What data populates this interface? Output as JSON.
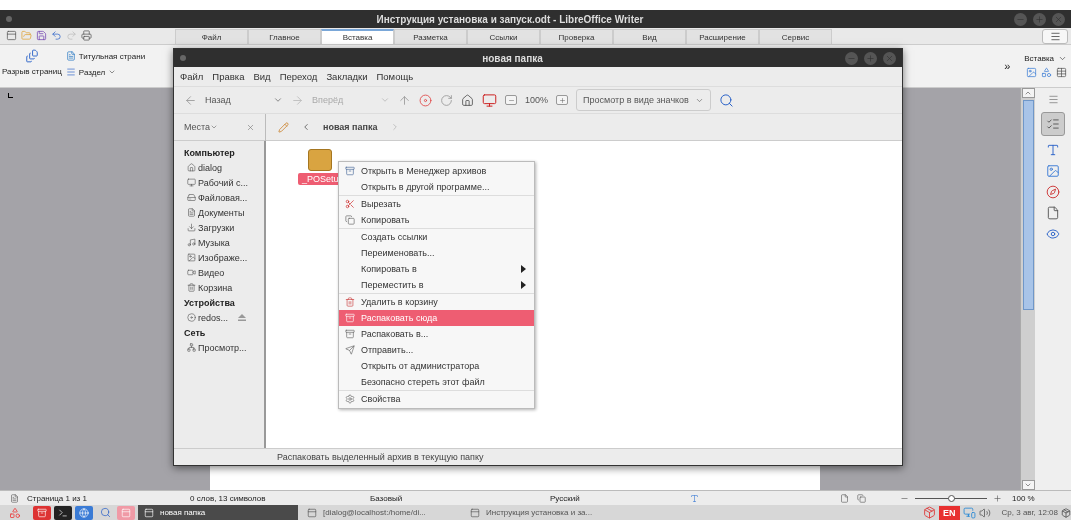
{
  "writer": {
    "title": "Инструкция установка и запуск.odt - LibreOffice Writer",
    "tabs": [
      {
        "label": "Файл",
        "selected": false
      },
      {
        "label": "Главное",
        "selected": false
      },
      {
        "label": "Вставка",
        "selected": true
      },
      {
        "label": "Разметка",
        "selected": false
      },
      {
        "label": "Ссылки",
        "selected": false
      },
      {
        "label": "Проверка",
        "selected": false
      },
      {
        "label": "Вид",
        "selected": false
      },
      {
        "label": "Расширение",
        "selected": false
      },
      {
        "label": "Сервис",
        "selected": false
      }
    ],
    "ribbon": {
      "page_break": "Разрыв страниц",
      "title_page": "Титульная страни",
      "section": "Раздел",
      "more": "»",
      "panel": "Вставка"
    },
    "status_bar": {
      "page": "Страница 1 из 1",
      "words": "0 слов, 13 символов",
      "style": "Базовый",
      "language": "Русский",
      "zoom": "100 %",
      "zoom_slider": {
        "level": 0.5
      }
    }
  },
  "file_manager": {
    "title": "новая папка",
    "menu": [
      "Файл",
      "Правка",
      "Вид",
      "Переход",
      "Закладки",
      "Помощь"
    ],
    "toolbar": {
      "back": {
        "label": "Назад",
        "disabled": false
      },
      "forward": {
        "label": "Вперёд",
        "disabled": true
      },
      "zoom": "100%",
      "view": "Просмотр в виде значков"
    },
    "places_label": "Места",
    "path": "новая папка",
    "sidebar": [
      {
        "title": "Компьютер",
        "items": [
          "dialog",
          "Рабочий с...",
          "Файловая...",
          "Документы",
          "Загрузки",
          "Музыка",
          "Изображе...",
          "Видео",
          "Корзина"
        ]
      },
      {
        "title": "Устройства",
        "items": [
          "redos..."
        ]
      },
      {
        "title": "Сеть",
        "items": [
          "Просмотр..."
        ]
      }
    ],
    "file": {
      "name": "_POSetu",
      "selected": true
    },
    "context_menu": [
      [
        {
          "label": "Открыть в Менеджер архивов",
          "selected": false
        },
        {
          "label": "Открыть в другой программе...",
          "selected": false
        }
      ],
      [
        {
          "label": "Вырезать",
          "selected": false
        },
        {
          "label": "Копировать",
          "selected": false
        }
      ],
      [
        {
          "label": "Создать ссылки",
          "selected": false
        },
        {
          "label": "Переименовать...",
          "selected": false
        },
        {
          "label": "Копировать в",
          "selected": false,
          "submenu": true
        },
        {
          "label": "Переместить в",
          "selected": false,
          "submenu": true
        }
      ],
      [
        {
          "label": "Удалить в корзину",
          "selected": false
        },
        {
          "label": "Распаковать сюда",
          "selected": true
        },
        {
          "label": "Распаковать в...",
          "selected": false
        },
        {
          "label": "Отправить...",
          "selected": false
        },
        {
          "label": "Открыть от администратора",
          "selected": false
        },
        {
          "label": "Безопасно стереть этот файл",
          "selected": false
        }
      ],
      [
        {
          "label": "Свойства",
          "selected": false
        }
      ]
    ],
    "status": "Распаковать выделенный архив в текущую папку"
  },
  "taskbar": {
    "tasks": [
      {
        "label": "новая папка",
        "selected": true
      },
      {
        "label": "[dialog@localhost:/home/di...",
        "selected": false
      },
      {
        "label": "Инструкция установка и за...",
        "selected": false
      }
    ],
    "language": "EN",
    "clock": "Ср, 3 авг, 12:08"
  }
}
